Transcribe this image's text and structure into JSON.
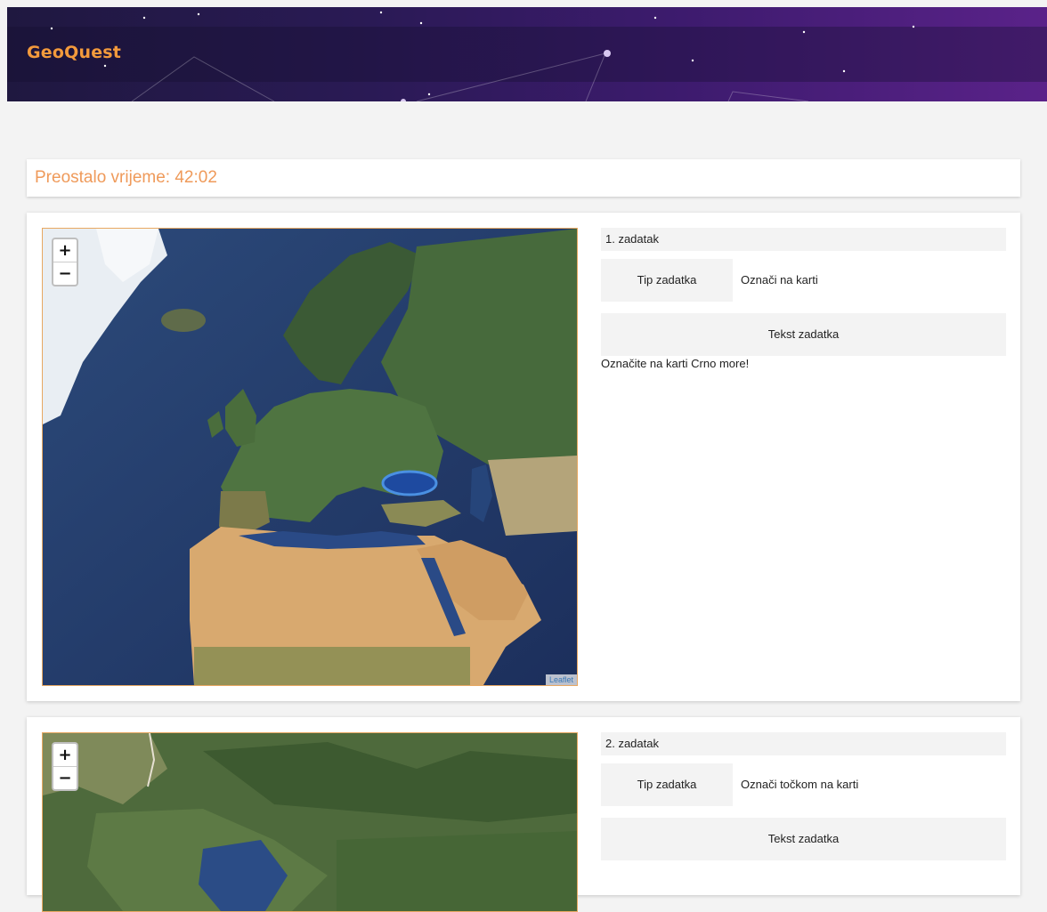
{
  "header": {
    "brand": "GeoQuest",
    "background_color": "#2a1a55",
    "brand_color": "#f39a3c"
  },
  "timer": {
    "text": "Preostalo vrijeme: 42:02",
    "color": "#ef9a5a"
  },
  "tasks": [
    {
      "number_label": "1. zadatak",
      "type_label": "Tip zadatka",
      "type_value": "Označi na karti",
      "text_label": "Tekst zadatka",
      "text_value": "Označite na karti Crno more!",
      "map": {
        "zoom_in": "+",
        "zoom_out": "−",
        "attribution": "Leaflet"
      }
    },
    {
      "number_label": "2. zadatak",
      "type_label": "Tip zadatka",
      "type_value": "Označi točkom na karti",
      "text_label": "Tekst zadatka",
      "map": {
        "zoom_in": "+",
        "zoom_out": "−"
      }
    }
  ]
}
